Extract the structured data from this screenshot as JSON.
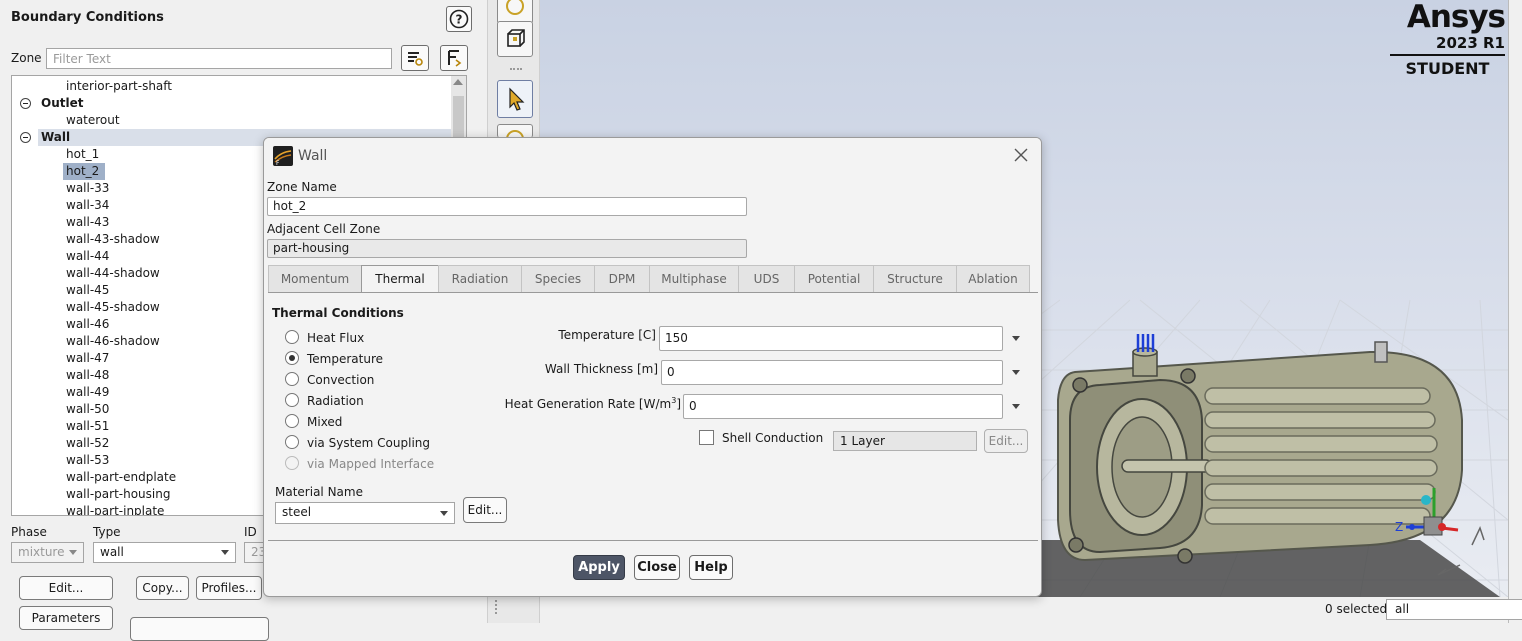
{
  "boundary_panel": {
    "title": "Boundary Conditions",
    "zone_label": "Zone",
    "filter_placeholder": "Filter Text",
    "tree": [
      {
        "label": "interior-part-shaft",
        "level": 1
      },
      {
        "label": "Outlet",
        "level": 0
      },
      {
        "label": "waterout",
        "level": 1
      },
      {
        "label": "Wall",
        "level": 0
      },
      {
        "label": "hot_1",
        "level": 1
      },
      {
        "label": "hot_2",
        "level": 1
      },
      {
        "label": "wall-33",
        "level": 1
      },
      {
        "label": "wall-34",
        "level": 1
      },
      {
        "label": "wall-43",
        "level": 1
      },
      {
        "label": "wall-43-shadow",
        "level": 1
      },
      {
        "label": "wall-44",
        "level": 1
      },
      {
        "label": "wall-44-shadow",
        "level": 1
      },
      {
        "label": "wall-45",
        "level": 1
      },
      {
        "label": "wall-45-shadow",
        "level": 1
      },
      {
        "label": "wall-46",
        "level": 1
      },
      {
        "label": "wall-46-shadow",
        "level": 1
      },
      {
        "label": "wall-47",
        "level": 1
      },
      {
        "label": "wall-48",
        "level": 1
      },
      {
        "label": "wall-49",
        "level": 1
      },
      {
        "label": "wall-50",
        "level": 1
      },
      {
        "label": "wall-51",
        "level": 1
      },
      {
        "label": "wall-52",
        "level": 1
      },
      {
        "label": "wall-53",
        "level": 1
      },
      {
        "label": "wall-part-endplate",
        "level": 1
      },
      {
        "label": "wall-part-housing",
        "level": 1
      },
      {
        "label": "wall-part-inplate",
        "level": 1
      }
    ],
    "phase_label": "Phase",
    "phase_value": "mixture",
    "type_label": "Type",
    "type_value": "wall",
    "id_label": "ID",
    "id_value": "23",
    "edit_button": "Edit...",
    "copy_button": "Copy...",
    "profiles_button": "Profiles...",
    "parameters_button": "Parameters"
  },
  "graphics": {
    "logo_name": "Ansys",
    "logo_version": "2023 R1",
    "logo_edition": "STUDENT",
    "selected_count": "0 selected",
    "selection_filter": "all",
    "axis_z": "Z"
  },
  "dialog": {
    "title": "Wall",
    "zone_name_label": "Zone Name",
    "zone_name_value": "hot_2",
    "adjacent_label": "Adjacent Cell Zone",
    "adjacent_value": "part-housing",
    "tabs": [
      "Momentum",
      "Thermal",
      "Radiation",
      "Species",
      "DPM",
      "Multiphase",
      "UDS",
      "Potential",
      "Structure",
      "Ablation"
    ],
    "active_tab": "Thermal",
    "thermal_conditions_title": "Thermal Conditions",
    "conditions": [
      {
        "label": "Heat Flux",
        "checked": false,
        "disabled": false
      },
      {
        "label": "Temperature",
        "checked": true,
        "disabled": false
      },
      {
        "label": "Convection",
        "checked": false,
        "disabled": false
      },
      {
        "label": "Radiation",
        "checked": false,
        "disabled": false
      },
      {
        "label": "Mixed",
        "checked": false,
        "disabled": false
      },
      {
        "label": "via System Coupling",
        "checked": false,
        "disabled": false
      },
      {
        "label": "via Mapped Interface",
        "checked": false,
        "disabled": true
      }
    ],
    "temperature_label": "Temperature [C]",
    "temperature_value": "150",
    "thickness_label": "Wall Thickness [m]",
    "thickness_value": "0",
    "heatgen_label_main": "Heat Generation Rate [W/m",
    "heatgen_label_sup": "3",
    "heatgen_label_end": "]",
    "heatgen_value": "0",
    "shell_conduction_label": "Shell Conduction",
    "shell_conduction_checked": false,
    "layers_value": "1 Layer",
    "shell_edit_button": "Edit...",
    "material_label": "Material Name",
    "material_value": "steel",
    "material_edit_button": "Edit...",
    "apply_button": "Apply",
    "close_button": "Close",
    "help_button": "Help"
  },
  "colors": {
    "selected_row": "#9fb0c8",
    "group_row": "#d9dfe9",
    "apply_bg": "#4d5566",
    "model_body": "#a8a88e",
    "model_dark": "#55574c"
  }
}
